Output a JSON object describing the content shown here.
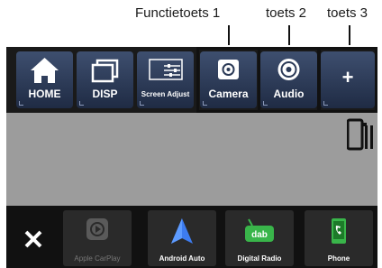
{
  "callouts": {
    "key1": "Functietoets 1",
    "key2": "toets 2",
    "key3": "toets 3"
  },
  "topbar": {
    "keys": [
      {
        "label": "HOME",
        "icon": "home-icon"
      },
      {
        "label": "DISP",
        "icon": "display-icon"
      },
      {
        "label": "Screen Adjust",
        "icon": "screen-adjust-icon"
      },
      {
        "label": "Camera",
        "icon": "camera-icon"
      },
      {
        "label": "Audio",
        "icon": "speaker-icon"
      },
      {
        "label": "+",
        "icon": "plus-icon"
      }
    ]
  },
  "bottombar": {
    "close_icon": "close-icon",
    "apps": [
      {
        "label": "Apple CarPlay",
        "icon": "carplay-icon",
        "enabled": false
      },
      {
        "label": "Android Auto",
        "icon": "android-auto-icon",
        "enabled": true
      },
      {
        "label": "Digital Radio",
        "icon": "dab-icon",
        "enabled": true
      },
      {
        "label": "Phone",
        "icon": "phone-icon",
        "enabled": true
      }
    ]
  },
  "colors": {
    "key_gradient_top": "#3e4f6f",
    "key_gradient_bottom": "#1f2b44",
    "screen_background": "#9c9c9c",
    "bar_background": "#1a1a1a"
  }
}
